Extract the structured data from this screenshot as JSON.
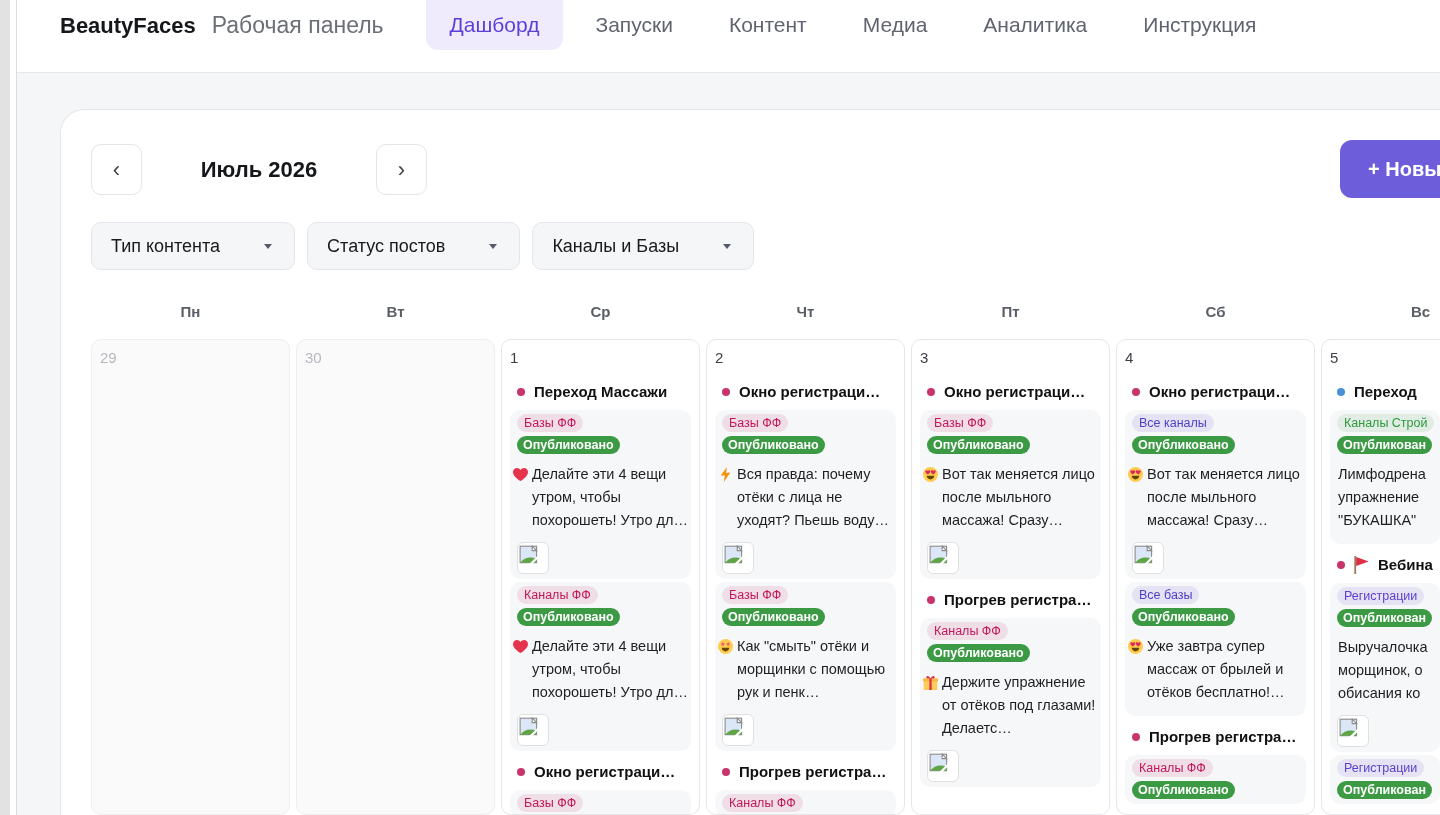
{
  "header": {
    "brand": "BeautyFaces",
    "subtitle": "Рабочая панель",
    "tabs": [
      {
        "label": "Дашборд",
        "selected": true
      },
      {
        "label": "Запуски",
        "selected": false
      },
      {
        "label": "Контент",
        "selected": false
      },
      {
        "label": "Медиа",
        "selected": false
      },
      {
        "label": "Аналитика",
        "selected": false
      },
      {
        "label": "Инструкция",
        "selected": false
      }
    ]
  },
  "calendar": {
    "prev_button": "‹",
    "month": "Июль 2026",
    "next_button": "›",
    "new_button": "+ Новы",
    "filters": [
      "Тип контента",
      "Статус постов",
      "Каналы и Базы"
    ],
    "weekdays": [
      "Пн",
      "Вт",
      "Ср",
      "Чт",
      "Пт",
      "Сб",
      "Вс"
    ],
    "days": [
      {
        "number": "29",
        "in_month": false
      },
      {
        "number": "30",
        "in_month": false
      },
      {
        "number": "1",
        "in_month": true,
        "events": [
          {
            "title": "Переход Массажи",
            "color": "#c8356c",
            "kind": "plain",
            "posts": [
              {
                "tag": {
                  "label": "Базы ФФ",
                  "color": "#c2185b"
                },
                "status": {
                  "label": "Опубликовано",
                  "kind": "published"
                },
                "kind": "heart",
                "text": "Делайте эти 4 вещи утром, чтобы похорошеть! Утро дл…",
                "image": true
              },
              {
                "tag": {
                  "label": "Каналы ФФ",
                  "color": "#c2185b"
                },
                "status": {
                  "label": "Опубликовано",
                  "kind": "published"
                },
                "kind": "heart",
                "text": "Делайте эти 4 вещи утром, чтобы похорошеть! Утро дл…",
                "image": true
              }
            ]
          },
          {
            "title": "Окно регистраци…",
            "color": "#c8356c",
            "kind": "plain",
            "posts": [
              {
                "tag": {
                  "label": "Базы ФФ",
                  "color": "#c2185b"
                }
              }
            ]
          }
        ]
      },
      {
        "number": "2",
        "in_month": true,
        "events": [
          {
            "title": "Окно регистраци…",
            "color": "#c8356c",
            "kind": "plain",
            "posts": [
              {
                "tag": {
                  "label": "Базы ФФ",
                  "color": "#c2185b"
                },
                "status": {
                  "label": "Опубликовано",
                  "kind": "published"
                },
                "kind": "bolt",
                "text": "Вся правда: почему отёки с лица не уходят? Пьешь воду…",
                "image": true
              },
              {
                "tag": {
                  "label": "Базы ФФ",
                  "color": "#c2185b"
                },
                "status": {
                  "label": "Опубликовано",
                  "kind": "published"
                },
                "kind": "star-eyes",
                "text": "Как \"смыть\" отёки и морщинки с помощью рук и пенк…",
                "image": true
              }
            ]
          },
          {
            "title": "Прогрев регистра…",
            "color": "#c8356c",
            "kind": "plain",
            "posts": [
              {
                "tag": {
                  "label": "Каналы ФФ",
                  "color": "#c2185b"
                }
              }
            ]
          }
        ]
      },
      {
        "number": "3",
        "in_month": true,
        "events": [
          {
            "title": "Окно регистраци…",
            "color": "#c8356c",
            "kind": "plain",
            "posts": [
              {
                "tag": {
                  "label": "Базы ФФ",
                  "color": "#c2185b"
                },
                "status": {
                  "label": "Опубликовано",
                  "kind": "published"
                },
                "kind": "heart-eyes",
                "text": "Вот так меняется лицо после мыльного массажа! Сразу…",
                "image": true
              }
            ]
          },
          {
            "title": "Прогрев регистра…",
            "color": "#c8356c",
            "kind": "plain",
            "posts": [
              {
                "tag": {
                  "label": "Каналы ФФ",
                  "color": "#c2185b"
                },
                "status": {
                  "label": "Опубликовано",
                  "kind": "published"
                },
                "kind": "gift",
                "text": "Держите упражнение от отёков под глазами! Делаетс…",
                "image": true
              }
            ]
          }
        ]
      },
      {
        "number": "4",
        "in_month": true,
        "events": [
          {
            "title": "Окно регистраци…",
            "color": "#c8356c",
            "kind": "plain",
            "posts": [
              {
                "tag": {
                  "label": "Все каналы",
                  "color": "#4f3fc8"
                },
                "status": {
                  "label": "Опубликовано",
                  "kind": "published"
                },
                "kind": "heart-eyes",
                "text": "Вот так меняется лицо после мыльного массажа! Сразу…",
                "image": true
              },
              {
                "tag": {
                  "label": "Все базы",
                  "color": "#4f3fc8"
                },
                "status": {
                  "label": "Опубликовано",
                  "kind": "published"
                },
                "kind": "heart-eyes",
                "text": "Уже завтра супер массаж от брылей и отёков бесплатно!…",
                "image": false
              }
            ]
          },
          {
            "title": "Прогрев регистра…",
            "color": "#c8356c",
            "kind": "plain",
            "posts": [
              {
                "tag": {
                  "label": "Каналы ФФ",
                  "color": "#c2185b"
                },
                "status": {
                  "label": "Опубликовано",
                  "kind": "published"
                }
              }
            ]
          }
        ]
      },
      {
        "number": "5",
        "in_month": true,
        "events": [
          {
            "title": "Переход",
            "color": "#4a90d9",
            "kind": "plain",
            "posts": [
              {
                "tag": {
                  "label": "Каналы Строй",
                  "color": "#2f9a3c"
                },
                "status": {
                  "label": "Опубликован",
                  "kind": "published"
                },
                "kind": "plain",
                "text": "Лимфодрена упражнение \"БУКАШКА\"",
                "image": false
              }
            ]
          },
          {
            "title": "Вебина",
            "color": "#c8356c",
            "kind": "flag",
            "posts": [
              {
                "tag": {
                  "label": "Регистрации",
                  "color": "#5b3fd0"
                },
                "status": {
                  "label": "Опубликован",
                  "kind": "published"
                },
                "kind": "plain",
                "text": "Выручалочка морщинок, о обисания ко",
                "image": true
              },
              {
                "tag": {
                  "label": "Регистрации",
                  "color": "#5b3fd0"
                },
                "status": {
                  "label": "Опубликован",
                  "kind": "published"
                }
              }
            ]
          }
        ]
      }
    ]
  }
}
